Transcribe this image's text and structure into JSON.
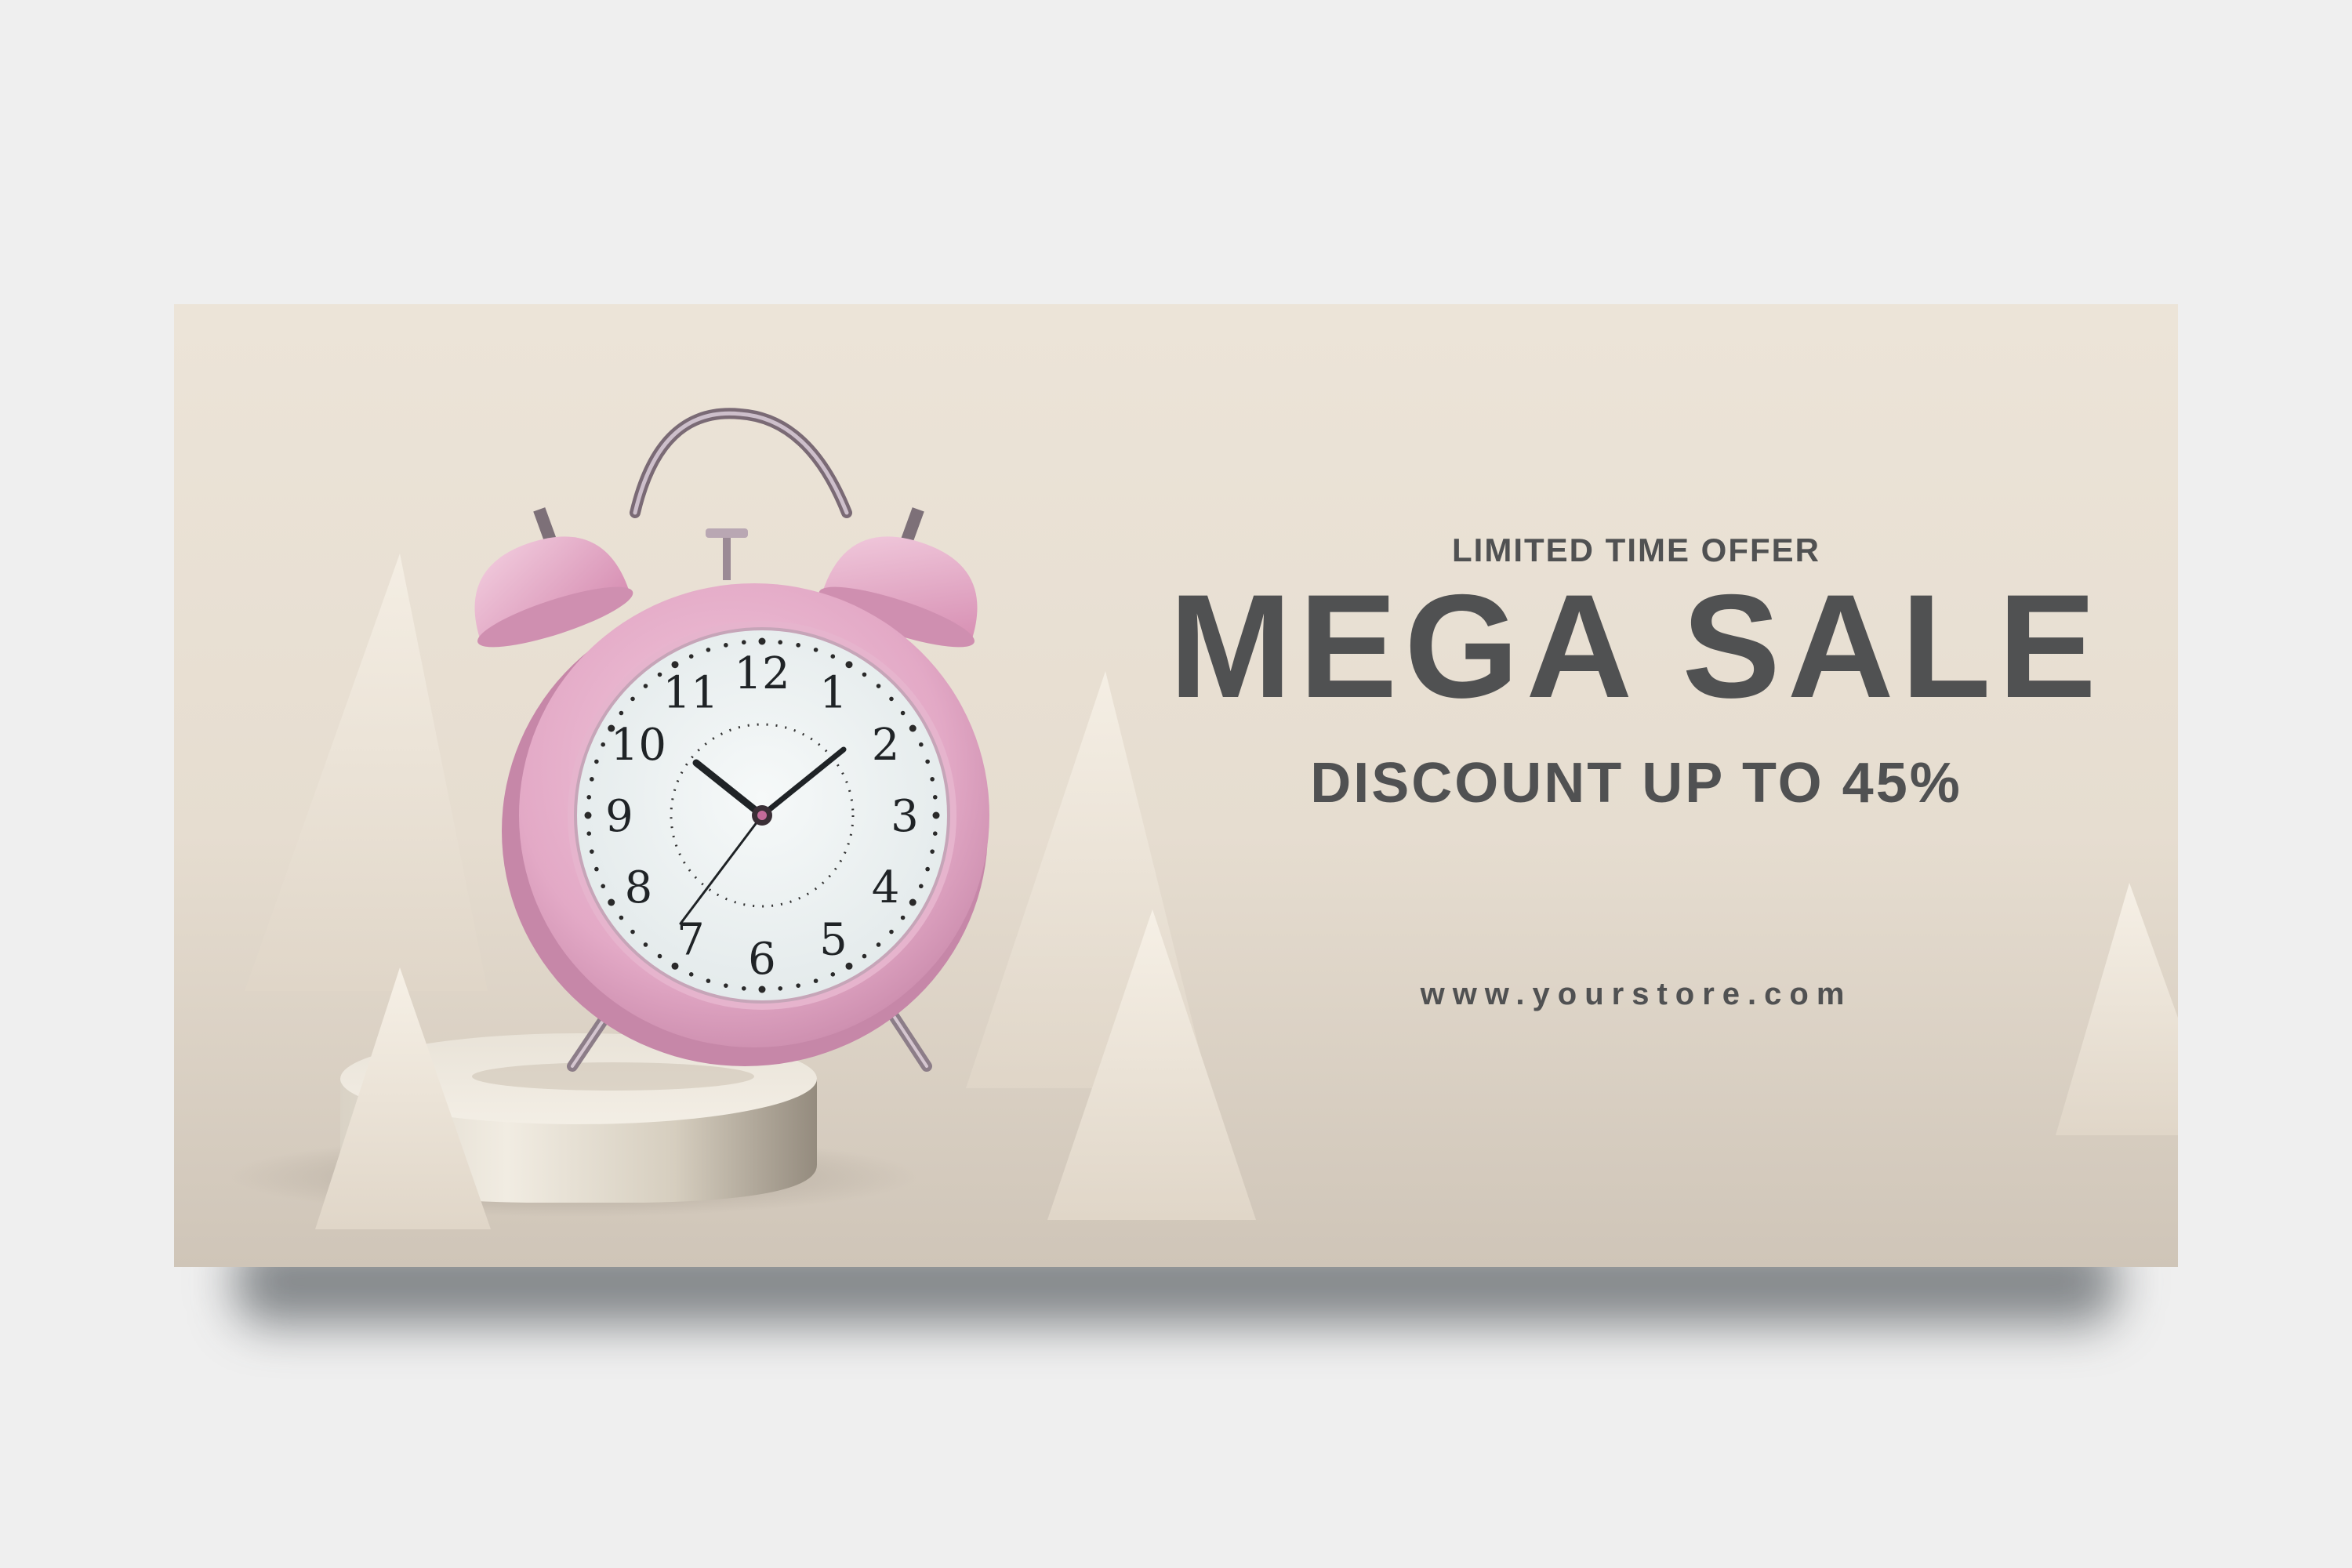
{
  "banner": {
    "eyebrow": "LIMITED TIME OFFER",
    "headline": "MEGA SALE",
    "subline": "DISCOUNT UP TO 45%",
    "website": "www.yourstore.com"
  },
  "clock": {
    "numerals": [
      "12",
      "1",
      "2",
      "3",
      "4",
      "5",
      "6",
      "7",
      "8",
      "9",
      "10",
      "11"
    ],
    "time_shown": "10:10:35",
    "case_color": "#e3a9c6",
    "dial_color": "#eef3f4"
  },
  "colors": {
    "background": "#efefef",
    "banner": "#e6ddd0",
    "text": "#505152",
    "shape": "#f3ece1"
  },
  "icons": [
    "alarm-clock-icon",
    "podium-shape",
    "triangle-shape"
  ]
}
